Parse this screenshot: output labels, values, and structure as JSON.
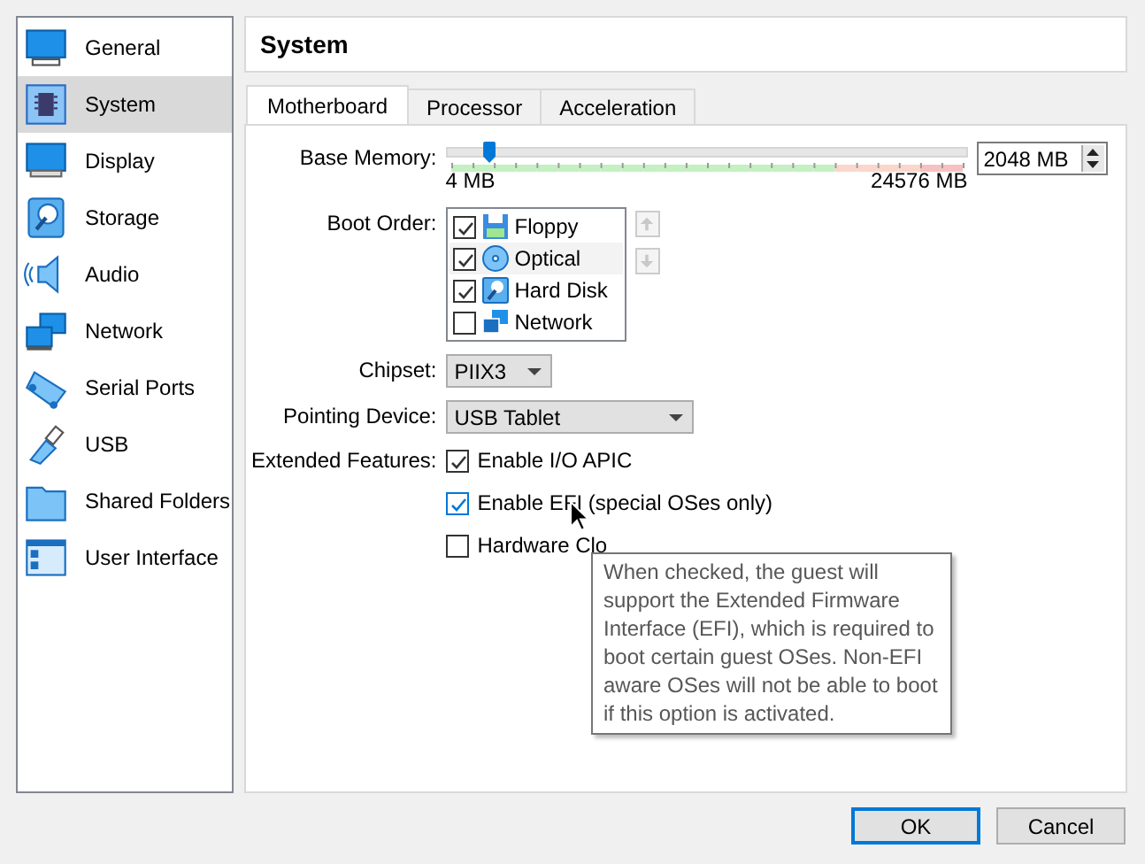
{
  "sidebar": {
    "items": [
      {
        "label": "General",
        "selected": false
      },
      {
        "label": "System",
        "selected": true
      },
      {
        "label": "Display",
        "selected": false
      },
      {
        "label": "Storage",
        "selected": false
      },
      {
        "label": "Audio",
        "selected": false
      },
      {
        "label": "Network",
        "selected": false
      },
      {
        "label": "Serial Ports",
        "selected": false
      },
      {
        "label": "USB",
        "selected": false
      },
      {
        "label": "Shared Folders",
        "selected": false
      },
      {
        "label": "User Interface",
        "selected": false
      }
    ]
  },
  "page_title": "System",
  "tabs": [
    {
      "label": "Motherboard",
      "selected": true
    },
    {
      "label": "Processor",
      "selected": false
    },
    {
      "label": "Acceleration",
      "selected": false
    }
  ],
  "base_memory": {
    "label": "Base Memory:",
    "level": 0.083,
    "value": "2048 MB",
    "min_label": "4 MB",
    "max_label": "24576 MB"
  },
  "boot_order": {
    "label": "Boot Order:",
    "items": [
      {
        "label": "Floppy",
        "checked": true,
        "selected": false
      },
      {
        "label": "Optical",
        "checked": true,
        "selected": true
      },
      {
        "label": "Hard Disk",
        "checked": true,
        "selected": false
      },
      {
        "label": "Network",
        "checked": false,
        "selected": false
      }
    ],
    "move_up": {
      "disabled": true
    },
    "move_down": {
      "disabled": true
    }
  },
  "chipset": {
    "label": "Chipset:",
    "value": "PIIX3"
  },
  "pointing_device": {
    "label": "Pointing Device:",
    "value": "USB Tablet"
  },
  "extended_features": {
    "label": "Extended Features:",
    "options": [
      {
        "label": "Enable I/O APIC",
        "checked": true,
        "hovered": false
      },
      {
        "label": "Enable EFI (special OSes only)",
        "checked": true,
        "hovered": true
      },
      {
        "label": "Hardware Clo",
        "checked": false,
        "hovered": false
      }
    ]
  },
  "tooltip": "When checked, the guest will support the Extended Firmware Interface (EFI), which is required to boot certain guest OSes. Non-EFI aware OSes will not be able to boot if this option is activated.",
  "buttons": [
    {
      "label": "OK",
      "default": true
    },
    {
      "label": "Cancel",
      "default": false
    }
  ]
}
